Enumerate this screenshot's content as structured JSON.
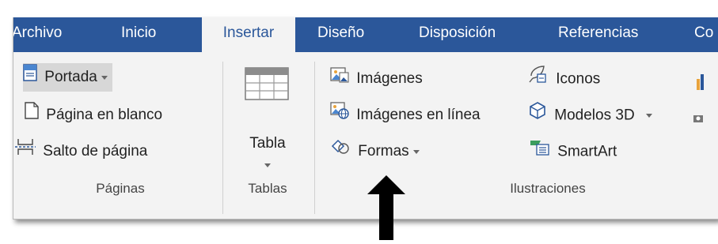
{
  "tabs": [
    "Archivo",
    "Inicio",
    "Insertar",
    "Diseño",
    "Disposición",
    "Referencias",
    "Co"
  ],
  "groups": {
    "paginas": {
      "label": "Páginas",
      "buttons": [
        "Portada",
        "Página en blanco",
        "Salto de página"
      ]
    },
    "tablas": {
      "label": "Tablas",
      "buttons": [
        "Tabla"
      ]
    },
    "ilustraciones": {
      "label": "Ilustraciones",
      "buttons": [
        "Imágenes",
        "Imágenes en línea",
        "Formas",
        "Iconos",
        "Modelos 3D",
        "SmartArt"
      ]
    }
  },
  "annotation": {
    "type": "arrow",
    "color": "#000000",
    "points_to": "Formas"
  },
  "colors": {
    "tab_bar": "#2b579a",
    "ribbon_background": "#f3f3f3",
    "active_tab_text": "#2b579a"
  }
}
